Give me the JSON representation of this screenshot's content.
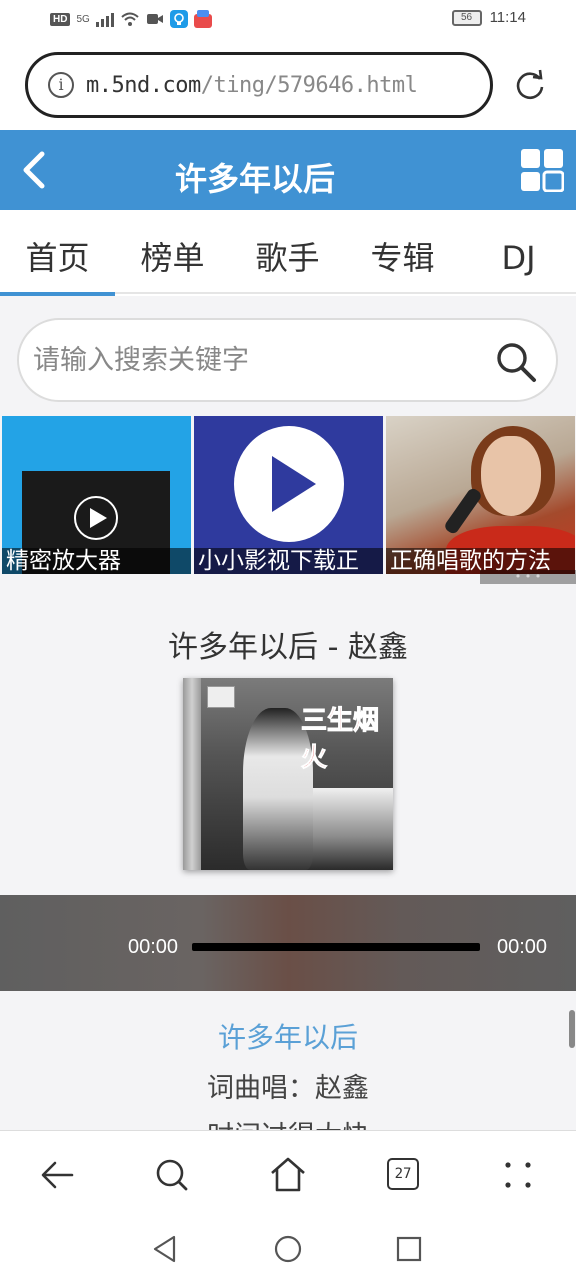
{
  "status_bar": {
    "network_chip": "HD",
    "signal_type": "5G",
    "battery": "56",
    "time": "11:14"
  },
  "url_bar": {
    "domain": "m.5nd.com",
    "path": "/ting/579646.html"
  },
  "header": {
    "title": "许多年以后"
  },
  "nav_tabs": [
    {
      "label": "首页",
      "active": true
    },
    {
      "label": "榜单",
      "active": false
    },
    {
      "label": "歌手",
      "active": false
    },
    {
      "label": "专辑",
      "active": false
    },
    {
      "label": "DJ",
      "active": false
    }
  ],
  "search": {
    "placeholder": "请输入搜索关键字"
  },
  "banners": [
    {
      "caption": "精密放大器"
    },
    {
      "caption": "小小影视下载正"
    },
    {
      "caption": "正确唱歌的方法"
    }
  ],
  "song": {
    "title": "许多年以后 - 赵鑫",
    "album_cover_text": "三生烟火",
    "current_time": "00:00",
    "duration": "00:00",
    "progress": 0
  },
  "lyrics": {
    "title": "许多年以后",
    "lines": [
      "词曲唱：赵鑫",
      "时间过得太快"
    ]
  },
  "browser_bar": {
    "tab_count": "27"
  },
  "colors": {
    "brand_blue": "#4092d3",
    "lyric_blue": "#5aa0d6"
  }
}
